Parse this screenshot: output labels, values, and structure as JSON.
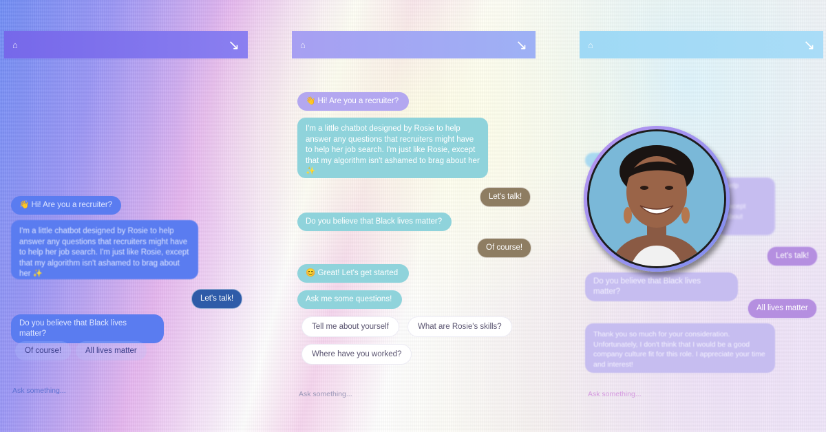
{
  "panels": [
    {
      "header_icon": "cake-icon",
      "header_arrow": "↘",
      "greeting": "👋 Hi! Are you a recruiter?",
      "intro": "I'm a little chatbot designed by Rosie to help answer any questions that recruiters might have to help her job search. I'm just like Rosie, except that my algorithm isn't ashamed to brag about her ✨",
      "user_reply": "Let's talk!",
      "question": "Do you believe that Black lives matter?",
      "options": [
        "Of course!",
        "All lives matter"
      ],
      "ask_placeholder": "Ask something..."
    },
    {
      "header_icon": "cake-icon",
      "header_arrow": "↘",
      "greeting": "👋 Hi! Are you a recruiter?",
      "intro": "I'm a little chatbot designed by Rosie to help answer any questions that recruiters might have to help her job search. I'm just like Rosie, except that my algorithm isn't ashamed to brag about her ✨",
      "user_reply": "Let's talk!",
      "question": "Do you believe that Black lives matter?",
      "answer": "Of course!",
      "great": "😊 Great! Let's get started",
      "prompt": "Ask me some questions!",
      "options": [
        "Tell me about yourself",
        "What are Rosie's skills?",
        "Where have you worked?"
      ],
      "ask_placeholder": "Ask something..."
    },
    {
      "header_icon": "cake-icon",
      "header_arrow": "↘",
      "intro_fragment": "help\nr\nexcept\nabout",
      "user_reply": "Let's talk!",
      "question": "Do you believe that Black lives matter?",
      "answer": "All lives matter",
      "rejection": "Thank you so much for your consideration. Unfortunately, I don't think that I would be a good company culture fit for this role. I appreciate your time and interest!",
      "ask_placeholder": "Ask something..."
    }
  ],
  "avatar": {
    "name": "portrait-avatar"
  },
  "colors": {
    "panel1_header": "#7668ea",
    "panel2_header": "#a79ff2",
    "panel3_header": "#9fd9f5",
    "panel2_user_bubble": "#8e7d62",
    "panel3_user_bubble": "#b58fe0"
  }
}
